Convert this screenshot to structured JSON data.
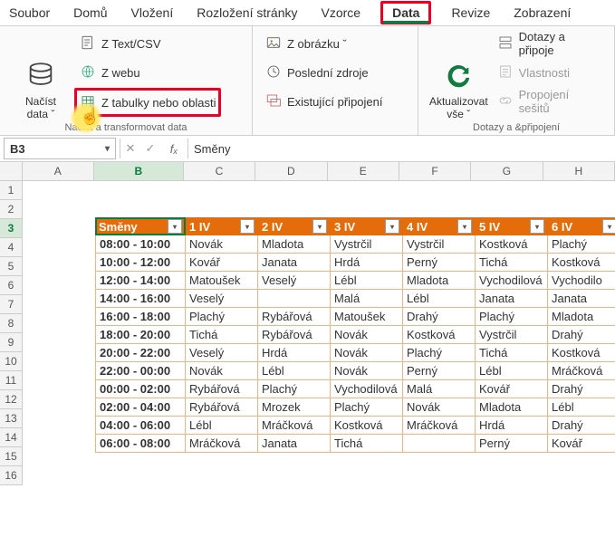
{
  "menu": {
    "tabs": [
      "Soubor",
      "Domů",
      "Vložení",
      "Rozložení stránky",
      "Vzorce",
      "Data",
      "Revize",
      "Zobrazení"
    ],
    "activeIndex": 5,
    "highlightedIndex": 5
  },
  "ribbon": {
    "group1": {
      "load_btn": "Načíst\ndata ˇ",
      "items": [
        "Z Text/CSV",
        "Z webu",
        "Z tabulky nebo oblasti"
      ],
      "highlightedItemIndex": 2,
      "label": "Načíst a transformovat data"
    },
    "group2": {
      "items": [
        "Z obrázku ˇ",
        "Poslední zdroje",
        "Existující připojení"
      ]
    },
    "group3": {
      "refresh_btn": "Aktualizovat\nvše ˇ",
      "items": [
        "Dotazy a připoje",
        "Vlastnosti",
        "Propojení sešitů"
      ],
      "disabled": [
        1,
        2
      ],
      "label": "Dotazy a &připojení"
    }
  },
  "fx": {
    "namebox": "B3",
    "value": "Směny"
  },
  "grid": {
    "cols": [
      "A",
      "B",
      "C",
      "D",
      "E",
      "F",
      "G",
      "H"
    ],
    "rowCount": 16,
    "activeRow": 3,
    "activeCol": "B",
    "headerTexts": [
      "Směny",
      "1 IV",
      "2 IV",
      "3 IV",
      "4 IV",
      "5 IV",
      "6 IV"
    ],
    "data": [
      [
        "08:00 - 10:00",
        "Novák",
        "Mladota",
        "Vystrčil",
        "Vystrčil",
        "Kostková",
        "Plachý"
      ],
      [
        "10:00 - 12:00",
        "Kovář",
        "Janata",
        "Hrdá",
        "Perný",
        "Tichá",
        "Kostková"
      ],
      [
        "12:00 - 14:00",
        "Matoušek",
        "Veselý",
        "Lébl",
        "Mladota",
        "Vychodilová",
        "Vychodilo"
      ],
      [
        "14:00 - 16:00",
        "Veselý",
        "",
        "Malá",
        "Lébl",
        "Janata",
        "Janata"
      ],
      [
        "16:00 - 18:00",
        "Plachý",
        "Rybářová",
        "Matoušek",
        "Drahý",
        "Plachý",
        "Mladota"
      ],
      [
        "18:00 - 20:00",
        "Tichá",
        "Rybářová",
        "Novák",
        "Kostková",
        "Vystrčil",
        "Drahý"
      ],
      [
        "20:00 - 22:00",
        "Veselý",
        "Hrdá",
        "Novák",
        "Plachý",
        "Tichá",
        "Kostková"
      ],
      [
        "22:00 - 00:00",
        "Novák",
        "Lébl",
        "Novák",
        "Perný",
        "Lébl",
        "Mráčková"
      ],
      [
        "00:00 - 02:00",
        "Rybářová",
        "Plachý",
        "Vychodilová",
        "Malá",
        "Kovář",
        "Drahý"
      ],
      [
        "02:00 - 04:00",
        "Rybářová",
        "Mrozek",
        "Plachý",
        "Novák",
        "Mladota",
        "Lébl"
      ],
      [
        "04:00 - 06:00",
        "Lébl",
        "Mráčková",
        "Kostková",
        "Mráčková",
        "Hrdá",
        "Drahý"
      ],
      [
        "06:00 - 08:00",
        "Mráčková",
        "Janata",
        "Tichá",
        "",
        "Perný",
        "Kovář"
      ]
    ]
  }
}
